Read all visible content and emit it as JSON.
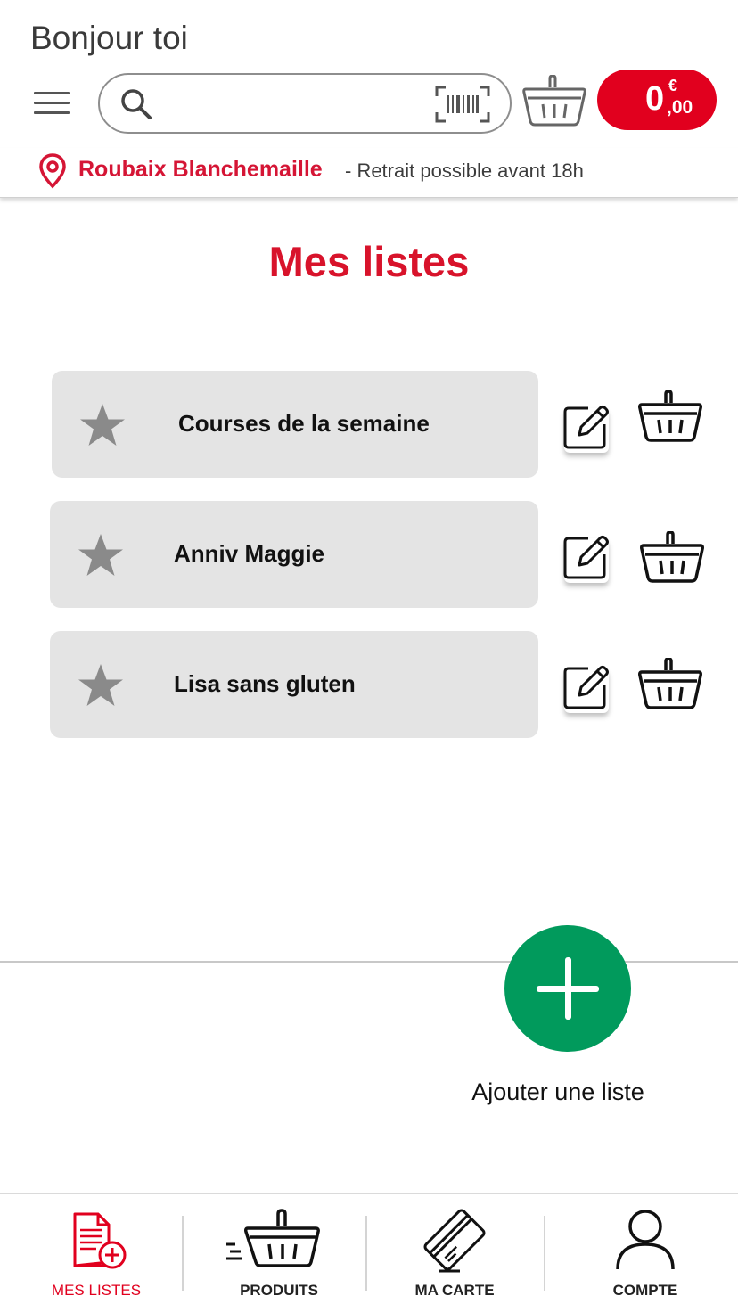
{
  "header": {
    "greeting": "Bonjour toi",
    "search_placeholder": "",
    "cart_total_integer": "0",
    "cart_total_currency": "€",
    "cart_total_cents": ",00"
  },
  "store": {
    "name": "Roubaix Blanchemaille",
    "pickup_info": "- Retrait possible avant 18h"
  },
  "main": {
    "title": "Mes listes",
    "lists": [
      {
        "name": "Courses de la semaine"
      },
      {
        "name": "Anniv Maggie"
      },
      {
        "name": "Lisa sans gluten"
      }
    ],
    "add_list_label": "Ajouter une liste"
  },
  "bottom_nav": {
    "items": [
      {
        "label": "MES LISTES",
        "icon": "list-add-icon",
        "active": true
      },
      {
        "label": "PRODUITS",
        "icon": "basket-fast-icon",
        "active": false
      },
      {
        "label": "MA CARTE",
        "icon": "loyalty-card-icon",
        "active": false
      },
      {
        "label": "COMPTE",
        "icon": "user-icon",
        "active": false
      }
    ]
  },
  "colors": {
    "brand_red": "#e1001e",
    "title_red": "#d8132b",
    "fab_green": "#019a5c",
    "card_gray": "#e4e4e4"
  }
}
